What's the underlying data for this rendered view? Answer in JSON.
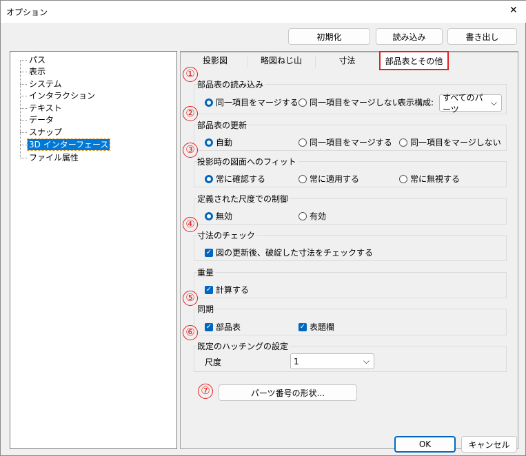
{
  "window": {
    "title": "オプション",
    "close": "✕"
  },
  "toolbar": {
    "reset": "初期化",
    "import": "読み込み",
    "export": "書き出し"
  },
  "tree": {
    "items": [
      "パス",
      "表示",
      "システム",
      "インタラクション",
      "テキスト",
      "データ",
      "スナップ",
      "3D インターフェース",
      "ファイル属性"
    ],
    "selected": "3D インターフェース"
  },
  "tabs": [
    "投影図",
    "略図ねじ山",
    "寸法",
    "部品表とその他"
  ],
  "active_tab": "部品表とその他",
  "markers": [
    "①",
    "②",
    "③",
    "④",
    "⑤",
    "⑥",
    "⑦"
  ],
  "groups": {
    "bom_import": {
      "title": "部品表の読み込み",
      "opt1": "同一項目をマージする",
      "opt2": "同一項目をマージしない",
      "config_label": "表示構成:",
      "config_value": "すべてのパーツ"
    },
    "bom_update": {
      "title": "部品表の更新",
      "opt1": "自動",
      "opt2": "同一項目をマージする",
      "opt3": "同一項目をマージしない"
    },
    "fit": {
      "title": "投影時の図面へのフィット",
      "opt1": "常に確認する",
      "opt2": "常に適用する",
      "opt3": "常に無視する"
    },
    "scale": {
      "title": "定義された尺度での制御",
      "opt1": "無効",
      "opt2": "有効"
    },
    "dimcheck": {
      "title": "寸法のチェック",
      "check": "図の更新後、破綻した寸法をチェックする"
    },
    "weight": {
      "title": "重量",
      "check": "計算する"
    },
    "sync": {
      "title": "同期",
      "check1": "部品表",
      "check2": "表題欄"
    },
    "hatch": {
      "title": "既定のハッチングの設定",
      "scale_label": "尺度",
      "scale_value": "1"
    }
  },
  "part_number_button": "パーツ番号の形状...",
  "footer": {
    "ok": "OK",
    "cancel": "キャンセル"
  },
  "colors": {
    "accent": "#0067c0",
    "highlight": "#e02020",
    "selection": "#0078d7"
  }
}
